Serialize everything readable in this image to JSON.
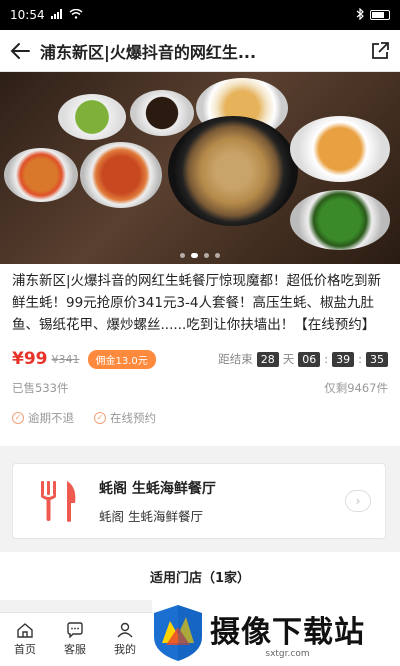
{
  "status_bar": {
    "time": "10:54",
    "icons": [
      "signal-icon",
      "wifi-icon",
      "bluetooth-icon",
      "battery-icon"
    ]
  },
  "nav": {
    "title": "浦东新区|火爆抖音的网红生...",
    "back_icon": "arrow-left-icon",
    "share_icon": "share-icon"
  },
  "hero": {
    "carousel_count": 4,
    "active_index": 1
  },
  "deal": {
    "description": "浦东新区|火爆抖音的网红生蚝餐厅惊现魔都！超低价格吃到新鲜生蚝！99元抢原价341元3-4人套餐！高压生蚝、椒盐九肚鱼、锡纸花甲、爆炒螺丝......吃到让你扶墙出！【在线预约】",
    "price": "¥99",
    "original_price": "¥341",
    "commission": "佣金13.0元",
    "countdown_label": "距结束",
    "countdown_days": "28",
    "days_unit": "天",
    "countdown_hours": "06",
    "countdown_minutes": "39",
    "countdown_seconds": "35",
    "sold": "已售533件",
    "remaining": "仅剩9467件",
    "tags": [
      "逾期不退",
      "在线预约"
    ],
    "accent_color": "#e8332a"
  },
  "shop": {
    "name": "蚝阁 生蚝海鲜餐厅",
    "subtitle": "蚝阁 生蚝海鲜餐厅",
    "icon": "fork-knife-icon"
  },
  "stores": {
    "title": "适用门店（1家）"
  },
  "tab_bar": {
    "items": [
      {
        "label": "首页",
        "icon": "home-icon"
      },
      {
        "label": "客服",
        "icon": "chat-icon"
      },
      {
        "label": "我的",
        "icon": "user-icon"
      }
    ]
  },
  "watermark": {
    "text": "摄像下载站",
    "url": "sxtgr.com"
  }
}
